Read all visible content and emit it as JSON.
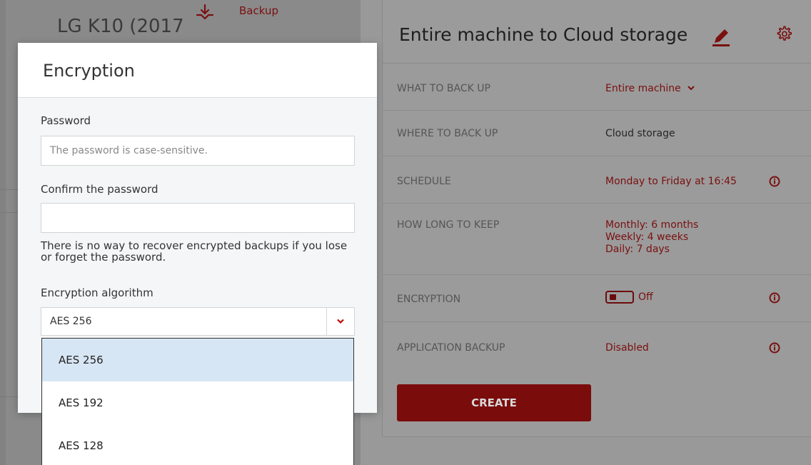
{
  "background": {
    "device_title": "LG K10 (2017",
    "backup_nav_label": "Backup"
  },
  "plan": {
    "title": "Entire machine to Cloud storage",
    "rows": [
      {
        "label": "WHAT TO BACK UP",
        "value": "Entire machine"
      },
      {
        "label": "WHERE TO BACK UP",
        "value": "Cloud storage"
      },
      {
        "label": "SCHEDULE",
        "value": "Monday to Friday at 16:45"
      },
      {
        "label": "HOW LONG TO KEEP",
        "value_lines": [
          "Monthly: 6 months",
          "Weekly: 4 weeks",
          "Daily: 7 days"
        ]
      },
      {
        "label": "ENCRYPTION",
        "value": "Off"
      },
      {
        "label": "APPLICATION BACKUP",
        "value": "Disabled"
      }
    ],
    "create_label": "CREATE"
  },
  "encryption_dialog": {
    "title": "Encryption",
    "password_label": "Password",
    "password_placeholder": "The password is case-sensitive.",
    "confirm_label": "Confirm the password",
    "confirm_value": "",
    "note": "There is no way to recover encrypted backups if you lose or forget the password.",
    "algorithm_label": "Encryption algorithm",
    "algorithm_selected": "AES 256",
    "algorithm_options": [
      "AES 256",
      "AES 192",
      "AES 128"
    ]
  },
  "colors": {
    "accent": "#c00000",
    "selected_option_bg": "#d7e6f4"
  },
  "icons": {
    "backup": "backup-download-icon",
    "edit": "pencil-icon",
    "settings": "gear-icon",
    "info": "info-icon",
    "dropdown": "chevron-down-icon"
  }
}
